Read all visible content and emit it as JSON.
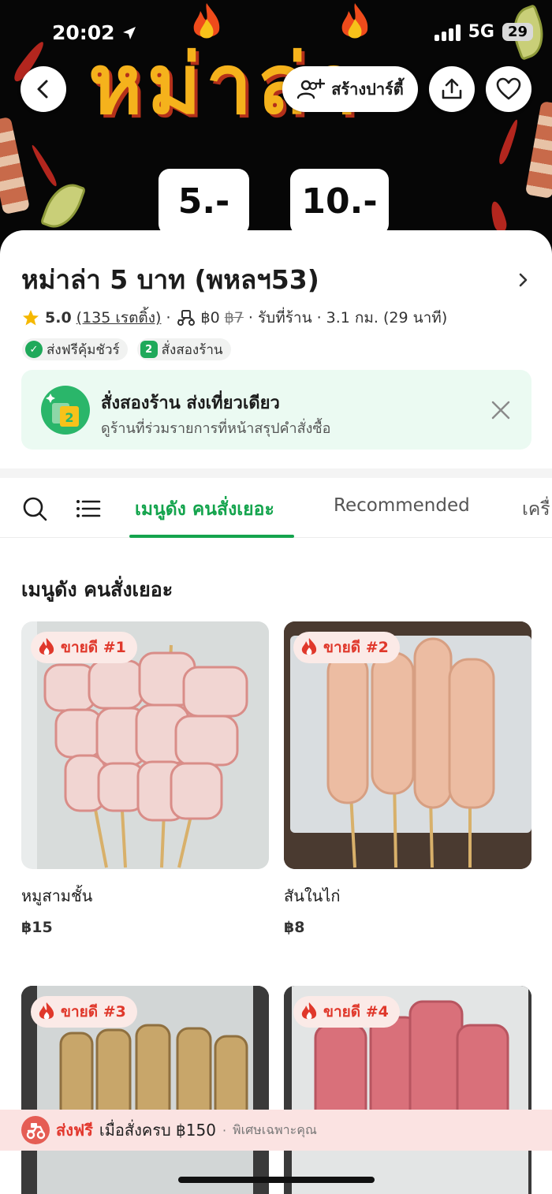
{
  "status_bar": {
    "time": "20:02",
    "network": "5G",
    "battery": "29"
  },
  "hero": {
    "title": "หม่าล่า",
    "price_tags": [
      "5.-",
      "10.-"
    ],
    "create_party_label": "สร้างปาร์ตี้"
  },
  "store": {
    "name": "หม่าล่า 5 บาท (พหลฯ53)",
    "rating": "5.0",
    "rating_count": "(135 เรตติ้ง)",
    "delivery_fee": "฿0",
    "original_fee": "฿7",
    "pickup": "รับที่ร้าน",
    "distance": "3.1 กม. (29 นาที)",
    "separator": "·",
    "tags": [
      "ส่งฟรีคุ้มชัวร์",
      "สั่งสองร้าน"
    ]
  },
  "promo": {
    "title": "สั่งสองร้าน ส่งเที่ยวเดียว",
    "subtitle": "ดูร้านที่ร่วมรายการที่หน้าสรุปคำสั่งซื้อ",
    "icon_number": "2"
  },
  "tabs": [
    {
      "label": "เมนูดัง คนสั่งเยอะ",
      "active": true
    },
    {
      "label": "Recommended",
      "active": false
    },
    {
      "label": "เครื่",
      "active": false
    }
  ],
  "section_title": "เมนูดัง คนสั่งเยอะ",
  "menu_items": [
    {
      "badge": "ขายดี #1",
      "name": "หมูสามชั้น",
      "price": "฿15"
    },
    {
      "badge": "ขายดี #2",
      "name": "สันในไก่",
      "price": "฿8"
    },
    {
      "badge": "ขายดี #3",
      "name": "",
      "price": ""
    },
    {
      "badge": "ขายดี #4",
      "name": "",
      "price": ""
    }
  ],
  "free_delivery": {
    "strong": "ส่งฟรี",
    "text": "เมื่อสั่งครบ ฿150",
    "note": "พิเศษเฉพาะคุณ"
  },
  "colors": {
    "accent_green": "#14a44d",
    "hot_red": "#e0382b",
    "banner_yellow": "#f5b21c"
  }
}
